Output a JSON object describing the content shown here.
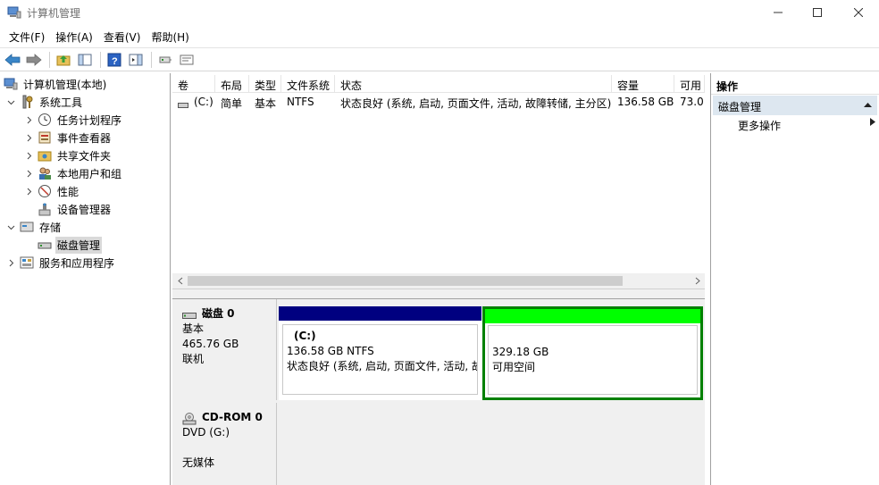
{
  "window": {
    "title": "计算机管理",
    "accent": "#2b5797"
  },
  "menu": [
    "文件(F)",
    "操作(A)",
    "查看(V)",
    "帮助(H)"
  ],
  "toolbar": {
    "icons": [
      "back-arrow-icon",
      "forward-arrow-icon",
      "up-folder-icon",
      "show-hide-tree-icon",
      "help-icon",
      "properties-icon",
      "connect-icon",
      "settings-icon"
    ]
  },
  "tree": {
    "root": "计算机管理(本地)",
    "system_tools": "系统工具",
    "task_scheduler": "任务计划程序",
    "event_viewer": "事件查看器",
    "shared_folders": "共享文件夹",
    "local_users": "本地用户和组",
    "performance": "性能",
    "device_manager": "设备管理器",
    "storage": "存储",
    "disk_management": "磁盘管理",
    "services": "服务和应用程序"
  },
  "volume_table": {
    "headers": [
      "卷",
      "布局",
      "类型",
      "文件系统",
      "状态",
      "容量",
      "可用"
    ],
    "rows": [
      {
        "volume": "(C:)",
        "layout": "简单",
        "type": "基本",
        "fs": "NTFS",
        "status": "状态良好 (系统, 启动, 页面文件, 活动, 故障转储, 主分区)",
        "capacity": "136.58 GB",
        "free": "73.0"
      }
    ]
  },
  "disks": [
    {
      "name": "磁盘 0",
      "type": "基本",
      "size": "465.76 GB",
      "state": "联机",
      "partitions": [
        {
          "label": "(C:)",
          "size_fs": "136.58 GB NTFS",
          "status": "状态良好 (系统, 启动, 页面文件, 活动, 故",
          "color": "#000080"
        },
        {
          "label": "",
          "size_fs": "329.18 GB",
          "status": "可用空间",
          "color": "#00ff00"
        }
      ]
    },
    {
      "name": "CD-ROM 0",
      "type": "DVD (G:)",
      "state": "无媒体"
    }
  ],
  "actions": {
    "header": "操作",
    "group": "磁盘管理",
    "more": "更多操作"
  }
}
